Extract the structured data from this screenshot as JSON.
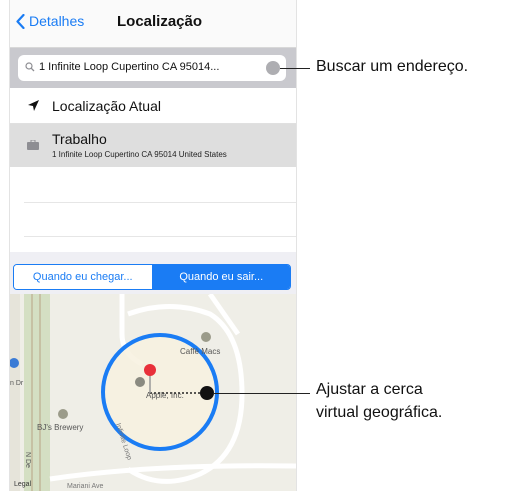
{
  "nav": {
    "back_label": "Detalhes",
    "title": "Localização"
  },
  "search": {
    "value": "1 Infinite Loop Cupertino CA 95014..."
  },
  "rows": {
    "current": {
      "label": "Localização Atual"
    },
    "work": {
      "label": "Trabalho",
      "address": "1 Infinite Loop Cupertino CA 95014 United States"
    }
  },
  "segment": {
    "arrive": "Quando eu chegar...",
    "leave": "Quando eu sair..."
  },
  "map": {
    "caffe": "Caffè Macs",
    "apple": "Apple, Inc.",
    "brewery": "BJ's Brewery",
    "loop": "Infinite Loop",
    "mariani": "Mariani Ave",
    "side_dr": "n Dr",
    "side_nde": "N De",
    "legal": "Legal"
  },
  "callouts": {
    "search": "Buscar um endereço.",
    "fence_line1": "Ajustar a cerca",
    "fence_line2": "virtual geográfica."
  },
  "colors": {
    "accent": "#1a7cf4",
    "pin": "#e8303a"
  }
}
